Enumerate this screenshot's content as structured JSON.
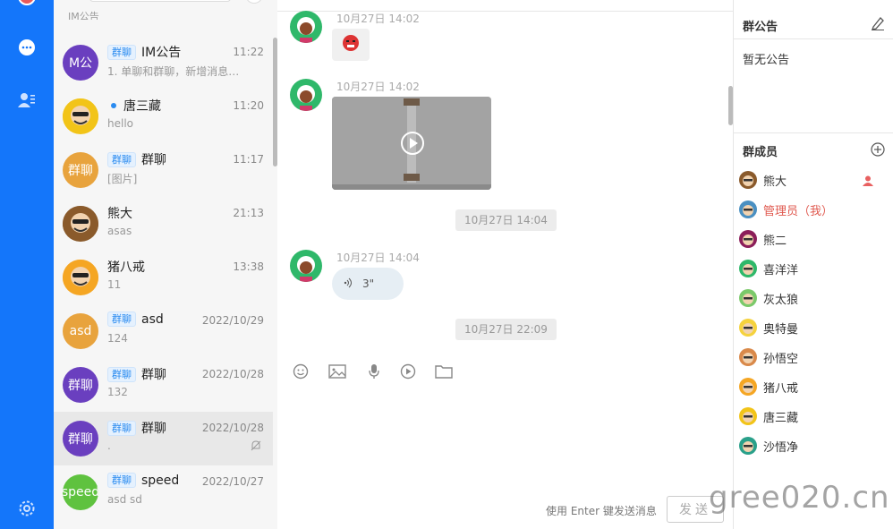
{
  "rail": {
    "colors": {
      "bg": "#1476fa"
    },
    "icons": [
      "chat-bubble-icon",
      "contacts-icon",
      "settings-icon"
    ]
  },
  "conversations": {
    "top_cut_text": "IM公告",
    "items": [
      {
        "avatar_text": "M公",
        "avatar_color": "#6a3fbf",
        "tag": "群聊",
        "name": "IM公告",
        "time": "11:22",
        "preview": "1. 单聊和群聊，新增消息…",
        "online": false,
        "muted": false,
        "active": false,
        "avatar_icon": ""
      },
      {
        "avatar_text": "",
        "avatar_color": "#f2c418",
        "tag": "",
        "name": "唐三藏",
        "time": "11:20",
        "preview": "hello",
        "online": true,
        "muted": false,
        "active": false,
        "avatar_icon": "tang-sanzang-avatar-icon"
      },
      {
        "avatar_text": "群聊",
        "avatar_color": "#e8a33d",
        "tag": "群聊",
        "name": "群聊",
        "time": "11:17",
        "preview": "[图片]",
        "online": false,
        "muted": false,
        "active": false,
        "avatar_icon": ""
      },
      {
        "avatar_text": "",
        "avatar_color": "#8a5a2b",
        "tag": "",
        "name": "熊大",
        "time": "21:13",
        "preview": "asas",
        "online": false,
        "muted": false,
        "active": false,
        "avatar_icon": "bear-avatar-icon"
      },
      {
        "avatar_text": "",
        "avatar_color": "#f5a623",
        "tag": "",
        "name": "猪八戒",
        "time": "13:38",
        "preview": "11",
        "online": false,
        "muted": false,
        "active": false,
        "avatar_icon": "zhu-bajie-avatar-icon"
      },
      {
        "avatar_text": "asd",
        "avatar_color": "#e8a33d",
        "tag": "群聊",
        "name": "asd",
        "time": "2022/10/29",
        "preview": "124",
        "online": false,
        "muted": false,
        "active": false,
        "avatar_icon": ""
      },
      {
        "avatar_text": "群聊",
        "avatar_color": "#6a3fbf",
        "tag": "群聊",
        "name": "群聊",
        "time": "2022/10/28",
        "preview": "132",
        "online": false,
        "muted": false,
        "active": false,
        "avatar_icon": ""
      },
      {
        "avatar_text": "群聊",
        "avatar_color": "#6a3fbf",
        "tag": "群聊",
        "name": "群聊",
        "time": "2022/10/28",
        "preview": ".",
        "online": false,
        "muted": true,
        "active": true,
        "avatar_icon": ""
      },
      {
        "avatar_text": "speed",
        "avatar_color": "#5fc23f",
        "tag": "群聊",
        "name": "speed",
        "time": "2022/10/27",
        "preview": "asd sd",
        "online": false,
        "muted": false,
        "active": false,
        "avatar_icon": ""
      }
    ]
  },
  "chat": {
    "messages": [
      {
        "time": "10月27日 14:02",
        "type": "emoji",
        "emoji_icon": "angry-face-emoji-icon"
      },
      {
        "time": "10月27日 14:02",
        "type": "video"
      },
      {
        "system_time": "10月27日 14:04"
      },
      {
        "time": "10月27日 14:04",
        "type": "voice",
        "duration": "3\""
      },
      {
        "system_time": "10月27日 22:09"
      }
    ],
    "toolbar": [
      "emoji-icon",
      "image-icon",
      "microphone-icon",
      "video-icon",
      "folder-icon"
    ],
    "hint": "使用 Enter 键发送消息",
    "send_label": "发送"
  },
  "side": {
    "announcement_title": "群公告",
    "announcement_body": "暂无公告",
    "members_title": "群成员",
    "members": [
      {
        "name": "熊大",
        "is_admin": false,
        "owner_badge": true,
        "color": "#8a5a2b"
      },
      {
        "name": "管理员（我）",
        "is_admin": true,
        "owner_badge": false,
        "color": "#4a90c2"
      },
      {
        "name": "熊二",
        "is_admin": false,
        "owner_badge": false,
        "color": "#8b1e5a"
      },
      {
        "name": "喜洋洋",
        "is_admin": false,
        "owner_badge": false,
        "color": "#2fb86a"
      },
      {
        "name": "灰太狼",
        "is_admin": false,
        "owner_badge": false,
        "color": "#7bc96a"
      },
      {
        "name": "奥特曼",
        "is_admin": false,
        "owner_badge": false,
        "color": "#f5d23d"
      },
      {
        "name": "孙悟空",
        "is_admin": false,
        "owner_badge": false,
        "color": "#d9894a"
      },
      {
        "name": "猪八戒",
        "is_admin": false,
        "owner_badge": false,
        "color": "#f5a623"
      },
      {
        "name": "唐三藏",
        "is_admin": false,
        "owner_badge": false,
        "color": "#f2c418"
      },
      {
        "name": "沙悟净",
        "is_admin": false,
        "owner_badge": false,
        "color": "#2aa08a"
      }
    ]
  },
  "watermark": "gree020.cn"
}
